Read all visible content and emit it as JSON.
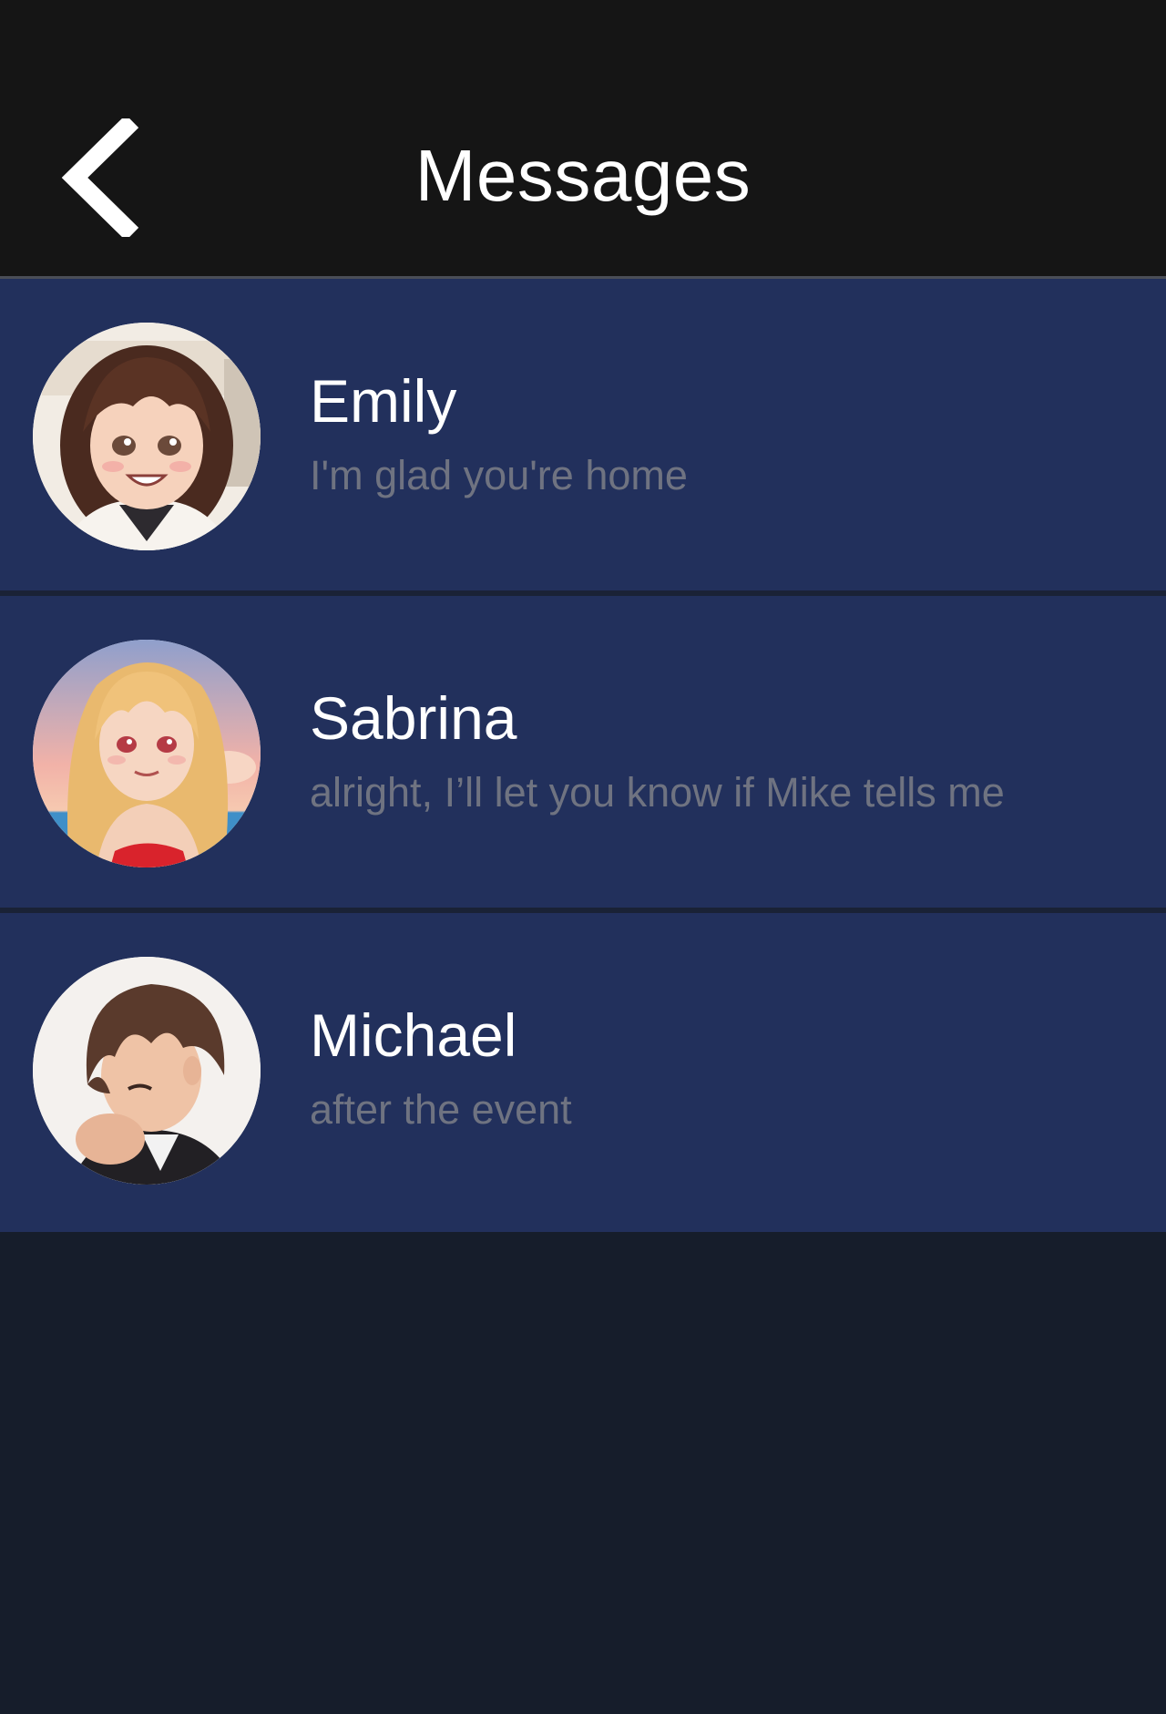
{
  "header": {
    "title": "Messages",
    "back_icon": "chevron-left-icon"
  },
  "conversations": [
    {
      "name": "Emily",
      "preview": "I'm glad you're home"
    },
    {
      "name": "Sabrina",
      "preview": "alright, I’ll let you know if Mike tells me"
    },
    {
      "name": "Michael",
      "preview": "after the event"
    }
  ],
  "colors": {
    "header_bg": "#151515",
    "row_bg": "#22305c",
    "page_bg": "#161d2b",
    "preview_text": "#6f7381"
  }
}
